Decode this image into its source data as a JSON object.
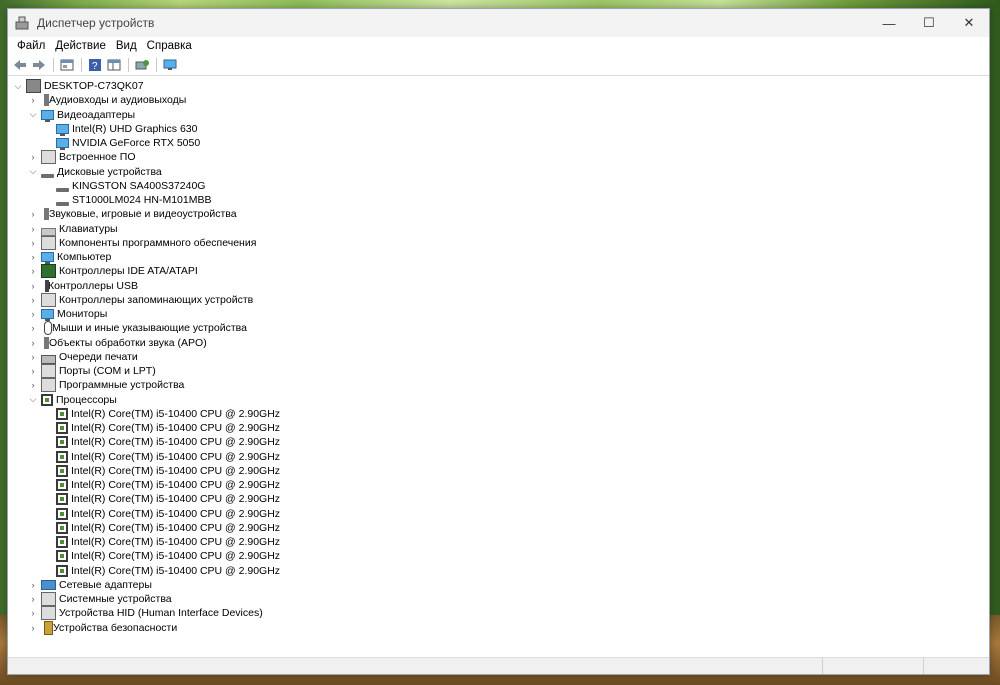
{
  "window": {
    "title": "Диспетчер устройств",
    "controls": {
      "minimize": "—",
      "maximize": "☐",
      "close": "✕"
    }
  },
  "menu": [
    "Файл",
    "Действие",
    "Вид",
    "Справка"
  ],
  "toolbar": [
    "back-icon",
    "forward-icon",
    "properties-icon",
    "help-icon",
    "view-icon",
    "update-driver-icon",
    "monitor-icon"
  ],
  "tree": {
    "root": "DESKTOP-C73QK07",
    "items": [
      {
        "label": "Аудиовходы и аудиовыходы",
        "icon": "speaker-icon",
        "expanded": false
      },
      {
        "label": "Видеоадаптеры",
        "icon": "monitor-icon",
        "expanded": true,
        "children": [
          {
            "label": "Intel(R) UHD Graphics 630",
            "icon": "monitor-icon"
          },
          {
            "label": "NVIDIA GeForce RTX 5050",
            "icon": "monitor-icon"
          }
        ]
      },
      {
        "label": "Встроенное ПО",
        "icon": "firmware-icon",
        "expanded": false
      },
      {
        "label": "Дисковые устройства",
        "icon": "disk-icon",
        "expanded": true,
        "children": [
          {
            "label": "KINGSTON SA400S37240G",
            "icon": "disk-icon"
          },
          {
            "label": "ST1000LM024 HN-M101MBB",
            "icon": "disk-icon"
          }
        ]
      },
      {
        "label": "Звуковые, игровые и видеоустройства",
        "icon": "speaker-icon",
        "expanded": false
      },
      {
        "label": "Клавиатуры",
        "icon": "keyboard-icon",
        "expanded": false
      },
      {
        "label": "Компоненты программного обеспечения",
        "icon": "software-component-icon",
        "expanded": false
      },
      {
        "label": "Компьютер",
        "icon": "computer-icon",
        "expanded": false
      },
      {
        "label": "Контроллеры IDE ATA/ATAPI",
        "icon": "chip-icon",
        "expanded": false
      },
      {
        "label": "Контроллеры USB",
        "icon": "usb-icon",
        "expanded": false
      },
      {
        "label": "Контроллеры запоминающих устройств",
        "icon": "storage-controller-icon",
        "expanded": false
      },
      {
        "label": "Мониторы",
        "icon": "monitor-icon",
        "expanded": false
      },
      {
        "label": "Мыши и иные указывающие устройства",
        "icon": "mouse-icon",
        "expanded": false
      },
      {
        "label": "Объекты обработки звука (APO)",
        "icon": "speaker-icon",
        "expanded": false
      },
      {
        "label": "Очереди печати",
        "icon": "printer-icon",
        "expanded": false
      },
      {
        "label": "Порты (COM и LPT)",
        "icon": "port-icon",
        "expanded": false
      },
      {
        "label": "Программные устройства",
        "icon": "software-device-icon",
        "expanded": false
      },
      {
        "label": "Процессоры",
        "icon": "cpu-icon",
        "expanded": true,
        "children": [
          {
            "label": "Intel(R) Core(TM) i5-10400 CPU @ 2.90GHz",
            "icon": "cpu-icon"
          },
          {
            "label": "Intel(R) Core(TM) i5-10400 CPU @ 2.90GHz",
            "icon": "cpu-icon"
          },
          {
            "label": "Intel(R) Core(TM) i5-10400 CPU @ 2.90GHz",
            "icon": "cpu-icon"
          },
          {
            "label": "Intel(R) Core(TM) i5-10400 CPU @ 2.90GHz",
            "icon": "cpu-icon"
          },
          {
            "label": "Intel(R) Core(TM) i5-10400 CPU @ 2.90GHz",
            "icon": "cpu-icon"
          },
          {
            "label": "Intel(R) Core(TM) i5-10400 CPU @ 2.90GHz",
            "icon": "cpu-icon"
          },
          {
            "label": "Intel(R) Core(TM) i5-10400 CPU @ 2.90GHz",
            "icon": "cpu-icon"
          },
          {
            "label": "Intel(R) Core(TM) i5-10400 CPU @ 2.90GHz",
            "icon": "cpu-icon"
          },
          {
            "label": "Intel(R) Core(TM) i5-10400 CPU @ 2.90GHz",
            "icon": "cpu-icon"
          },
          {
            "label": "Intel(R) Core(TM) i5-10400 CPU @ 2.90GHz",
            "icon": "cpu-icon"
          },
          {
            "label": "Intel(R) Core(TM) i5-10400 CPU @ 2.90GHz",
            "icon": "cpu-icon"
          },
          {
            "label": "Intel(R) Core(TM) i5-10400 CPU @ 2.90GHz",
            "icon": "cpu-icon"
          }
        ]
      },
      {
        "label": "Сетевые адаптеры",
        "icon": "network-icon",
        "expanded": false
      },
      {
        "label": "Системные устройства",
        "icon": "system-device-icon",
        "expanded": false
      },
      {
        "label": "Устройства HID (Human Interface Devices)",
        "icon": "hid-icon",
        "expanded": false
      },
      {
        "label": "Устройства безопасности",
        "icon": "security-icon",
        "expanded": false
      }
    ]
  }
}
